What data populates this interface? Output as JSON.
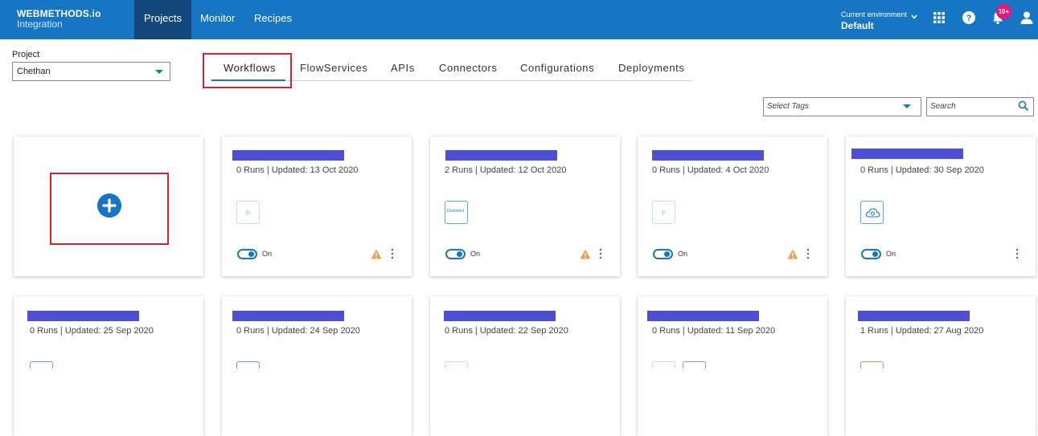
{
  "brand": {
    "line1": "WEBMETHODS.io",
    "line2": "Integration"
  },
  "nav": [
    "Projects",
    "Monitor",
    "Recipes"
  ],
  "environment": {
    "label": "Current environment",
    "value": "Default"
  },
  "notifications": {
    "badge": "10+"
  },
  "project": {
    "label": "Project",
    "selected": "Chethan"
  },
  "tabs": [
    "Workflows",
    "FlowServices",
    "APIs",
    "Connectors",
    "Configurations",
    "Deployments"
  ],
  "filters": {
    "tags_placeholder": "Select Tags",
    "search_placeholder": "Search"
  },
  "cards_row1": [
    {
      "meta": "0 Runs | Updated: 13 Oct 2020",
      "toggle": "On"
    },
    {
      "meta": "2 Runs | Updated: 12 Oct 2020",
      "toggle": "On",
      "app_label": "Dconnect"
    },
    {
      "meta": "0 Runs | Updated: 4 Oct 2020",
      "toggle": "On"
    },
    {
      "meta": "0 Runs | Updated: 30 Sep 2020",
      "toggle": "On"
    }
  ],
  "cards_row2": [
    {
      "meta": "0 Runs | Updated: 25 Sep 2020"
    },
    {
      "meta": "0 Runs | Updated: 24 Sep 2020"
    },
    {
      "meta": "0 Runs | Updated: 22 Sep 2020"
    },
    {
      "meta": "0 Runs | Updated: 11 Sep 2020"
    },
    {
      "meta": "1 Runs | Updated: 27 Aug 2020"
    }
  ],
  "colors": {
    "topbar": "#1676c4",
    "nav_active": "#12477a",
    "accent": "#1676c4",
    "badge": "#e9157f",
    "redacted": "#4c4fd4",
    "highlight": "#e0202a",
    "warning": "#f0a050"
  }
}
